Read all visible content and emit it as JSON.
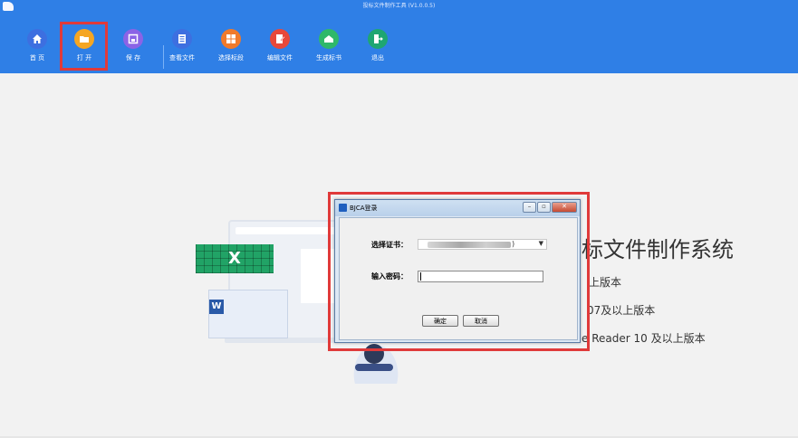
{
  "window": {
    "title": "投标文件制作工具 (V1.0.0.5)"
  },
  "toolbar": {
    "items": [
      {
        "label": "首 页",
        "icon": "home-icon",
        "color": "#3d6fe0"
      },
      {
        "label": "打 开",
        "icon": "folder-icon",
        "color": "#f5a623"
      },
      {
        "label": "保 存",
        "icon": "save-icon",
        "color": "#8b63e6"
      },
      {
        "label": "查看文件",
        "icon": "document-icon",
        "color": "#3d6fe0"
      },
      {
        "label": "选择标段",
        "icon": "grid-icon",
        "color": "#f07a2b"
      },
      {
        "label": "编辑文件",
        "icon": "edit-icon",
        "color": "#e8483a"
      },
      {
        "label": "生成标书",
        "icon": "generate-icon",
        "color": "#2fb86a"
      },
      {
        "label": "退出",
        "icon": "exit-icon",
        "color": "#1ea672"
      }
    ],
    "highlight_color": "#e03a3a"
  },
  "background": {
    "title_fragment": "标文件制作系统",
    "line1": "上版本",
    "line2": "07及以上版本",
    "line3": "e Reader 10 及以上版本"
  },
  "illustration": {
    "excel_letter": "X",
    "word_letter": "W"
  },
  "dialog": {
    "title": "BJCA登录",
    "cert_label": "选择证书：",
    "cert_suffix": ")",
    "password_label": "输入密码：",
    "password_value": "",
    "ok_button": "确定",
    "cancel_button": "取消",
    "minimize_glyph": "–",
    "maximize_glyph": "▫",
    "close_glyph": "✕"
  },
  "colors": {
    "toolbar_bg": "#2f7fe6",
    "page_bg": "#f2f2f2"
  }
}
